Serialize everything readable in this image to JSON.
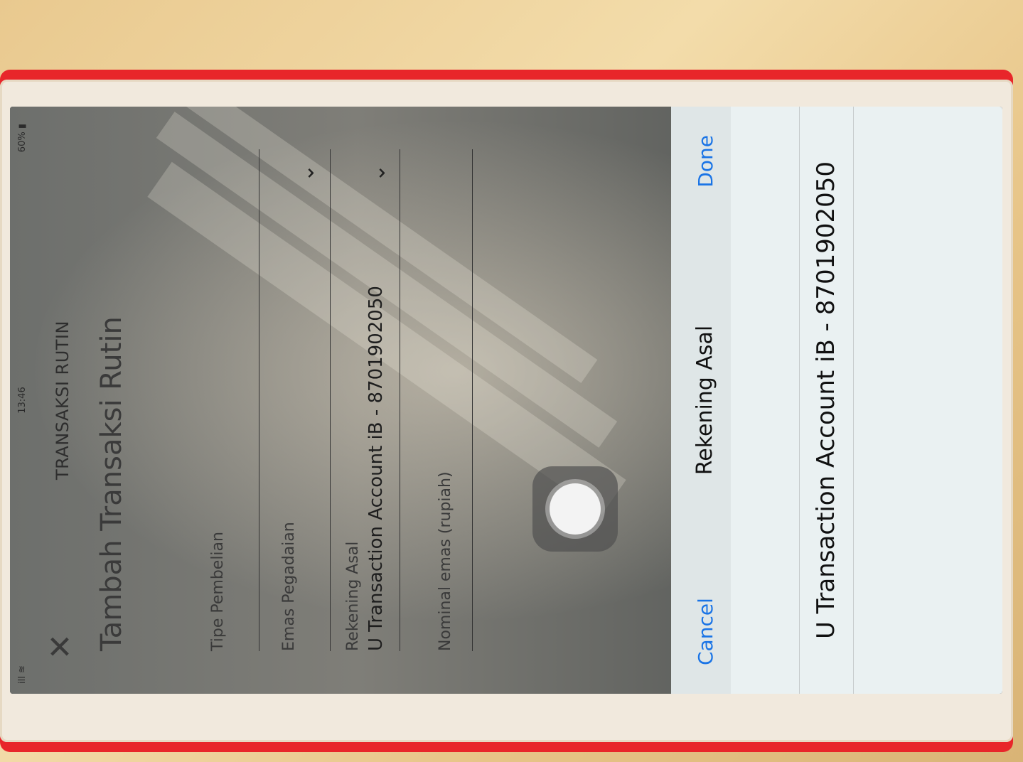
{
  "status": {
    "signal": "ill ≋",
    "time": "13:46",
    "battery": "60% ▮"
  },
  "header": {
    "title": "TRANSAKSI RUTIN"
  },
  "section": {
    "title": "Tambah Transaksi Rutin"
  },
  "form": {
    "fields": [
      {
        "label": "Tipe Pembelian",
        "value": ""
      },
      {
        "label": "Emas Pegadaian",
        "value": ""
      },
      {
        "label": "Rekening Asal",
        "value": "U Transaction Account iB - 8701902050"
      },
      {
        "label": "Nominal emas (rupiah)",
        "value": ""
      }
    ]
  },
  "picker": {
    "cancel_label": "Cancel",
    "title": "Rekening Asal",
    "done_label": "Done",
    "options": [
      "U Transaction Account iB - 8701902050"
    ]
  },
  "colors": {
    "accent": "#1a74e6",
    "case": "#e8262a"
  }
}
